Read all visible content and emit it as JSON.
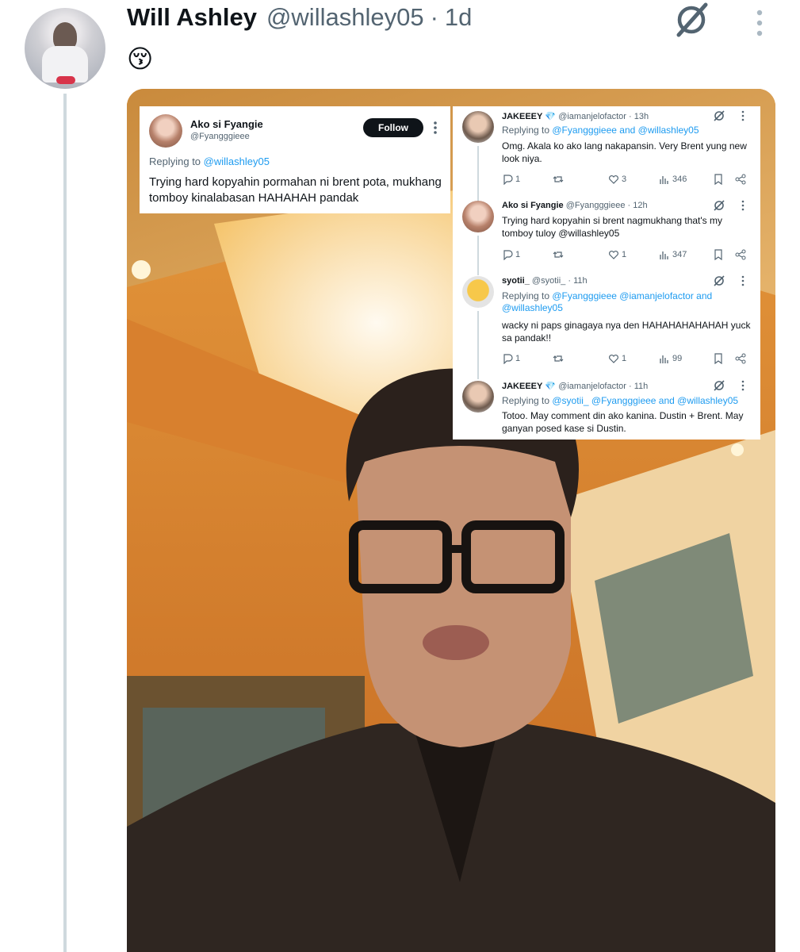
{
  "tweet": {
    "author_name": "Will Ashley",
    "author_handle": "@willashley05",
    "separator": "·",
    "time": "1d",
    "emoji": "😚"
  },
  "embedded": {
    "main": {
      "name": "Ako si Fyangie",
      "handle": "@Fyangggieee",
      "follow_label": "Follow",
      "replying_prefix": "Replying to ",
      "replying_to": "@willashley05",
      "text": "Trying hard kopyahin pormahan ni brent pota, mukhang tomboy kinalabasan HAHAHAH pandak"
    },
    "replies": [
      {
        "name": "JAKEEEY",
        "badge": "💎",
        "handle": "@iamanjelofactor",
        "time": "· 13h",
        "replying_prefix": "Replying to ",
        "replying_to": "@Fyangggieee and @willashley05",
        "text": "Omg. Akala ko ako lang nakapansin. Very Brent yung new look niya.",
        "replies": "1",
        "likes": "3",
        "views": "346"
      },
      {
        "name": "Ako si Fyangie",
        "badge": "",
        "handle": "@Fyangggieee",
        "time": "· 12h",
        "replying_prefix": "",
        "replying_to": "",
        "text": "Trying hard kopyahin si brent nagmukhang that's my tomboy tuloy @willashley05",
        "replies": "1",
        "likes": "1",
        "views": "347"
      },
      {
        "name": "syotii_",
        "badge": "",
        "handle": "@syotii_",
        "time": "· 11h",
        "replying_prefix": "Replying to ",
        "replying_to": "@Fyangggieee @iamanjelofactor and @willashley05",
        "text": "wacky ni paps ginagaya nya den HAHAHAHAHAHAH yuck sa pandak!!",
        "replies": "1",
        "likes": "1",
        "views": "99"
      },
      {
        "name": "JAKEEEY",
        "badge": "💎",
        "handle": "@iamanjelofactor",
        "time": "· 11h",
        "replying_prefix": "Replying to ",
        "replying_to": "@syotii_ @Fyangggieee and @willashley05",
        "text": "Totoo. May comment din ako kanina. Dustin + Brent. May ganyan posed kase si Dustin."
      }
    ]
  },
  "icons": {
    "grok": "grok-icon",
    "more": "more-vertical-icon",
    "reply": "reply-icon",
    "retweet": "retweet-icon",
    "like": "heart-icon",
    "views": "views-icon",
    "bookmark": "bookmark-icon",
    "share": "share-icon"
  },
  "colors": {
    "link": "#1d9bf0",
    "muted": "#536471",
    "text": "#0f1419"
  }
}
